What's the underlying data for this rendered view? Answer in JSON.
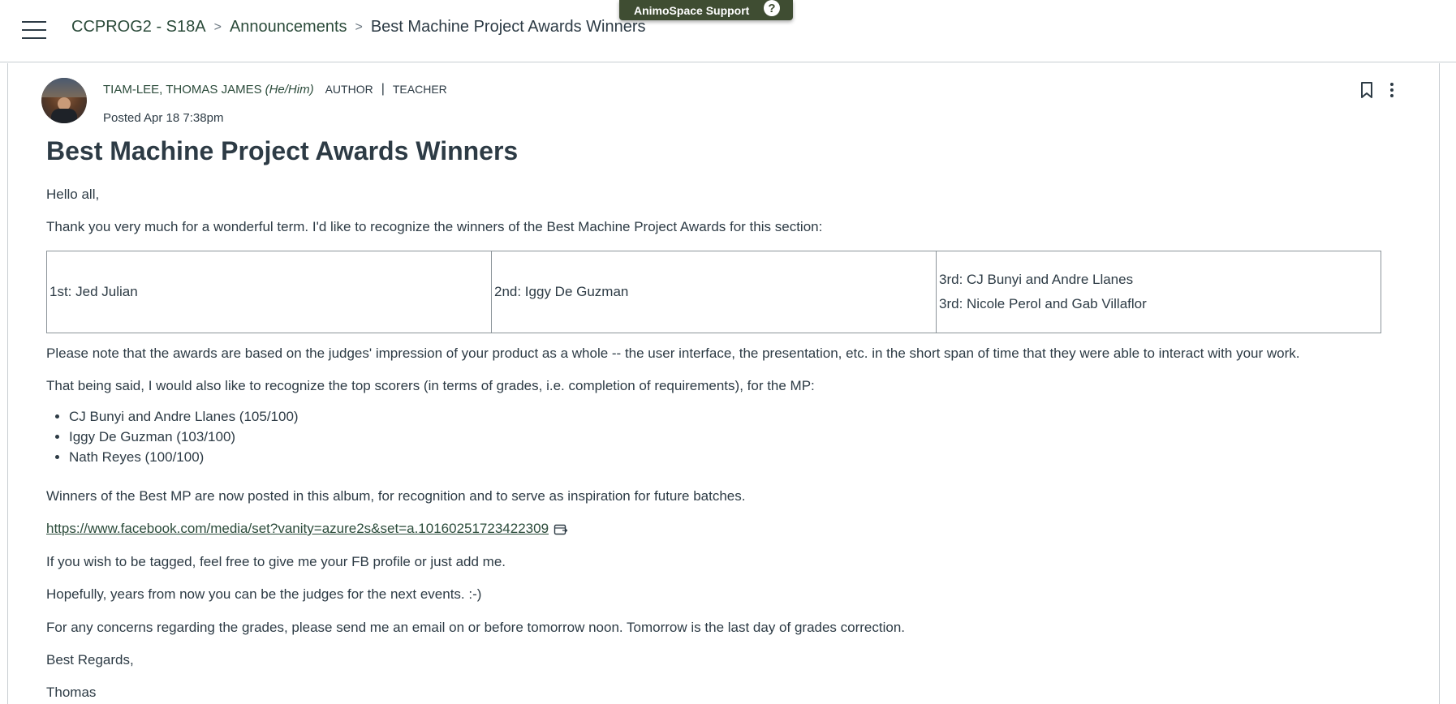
{
  "breadcrumb": {
    "course": "CCPROG2 - S18A",
    "section": "Announcements",
    "current": "Best Machine Project Awards Winners",
    "separator": ">"
  },
  "support": {
    "label": "AnimoSpace Support",
    "help_glyph": "?"
  },
  "author": {
    "name": "TIAM-LEE, THOMAS JAMES",
    "pronouns": "(He/Him)",
    "role_author": "AUTHOR",
    "role_divider": "|",
    "role_teacher": "TEACHER",
    "posted": "Posted Apr 18 7:38pm"
  },
  "icons": {
    "menu": "hamburger-menu-icon",
    "bookmark": "bookmark-icon",
    "options": "kebab-menu-icon",
    "external": "external-link-icon"
  },
  "colors": {
    "link": "#2b4b3a",
    "support_bg": "#3f4d32",
    "text": "#2d3b45",
    "border": "#c7cdd1"
  },
  "post": {
    "title": "Best Machine Project Awards Winners",
    "greeting": "Hello all,",
    "intro": "Thank you very much for a wonderful term. I'd like to recognize the winners of the Best Machine Project Awards for this section:",
    "awards": {
      "first": "1st: Jed Julian",
      "second": "2nd: Iggy De Guzman",
      "third_a": "3rd: CJ Bunyi and Andre Llanes",
      "third_b": "3rd: Nicole Perol and Gab Villaflor"
    },
    "note": "Please note that the awards are based on the judges' impression of your product as a whole -- the user interface, the presentation, etc. in the short span of time that they were able to interact with your work.",
    "top_scorers_intro": "That being said, I would also like to recognize the top scorers (in terms of grades, i.e. completion of requirements), for the MP:",
    "top_scorers": [
      "CJ Bunyi and Andre Llanes (105/100)",
      "Iggy De Guzman (103/100)",
      "Nath Reyes (100/100)"
    ],
    "album_text": "Winners of the Best MP are now posted in this album, for recognition and to serve as inspiration for future batches.",
    "album_link": "https://www.facebook.com/media/set?vanity=azure2s&set=a.10160251723422309",
    "tag_text": "If you wish to be tagged, feel free to give me your FB profile or just add me.",
    "hope_text": "Hopefully, years from now you can be the judges for the next events. :-)",
    "concerns_text": "For any concerns regarding the grades, please send me an email on or before tomorrow noon. Tomorrow is the last day of grades correction.",
    "closing": "Best Regards,",
    "signature": "Thomas"
  }
}
